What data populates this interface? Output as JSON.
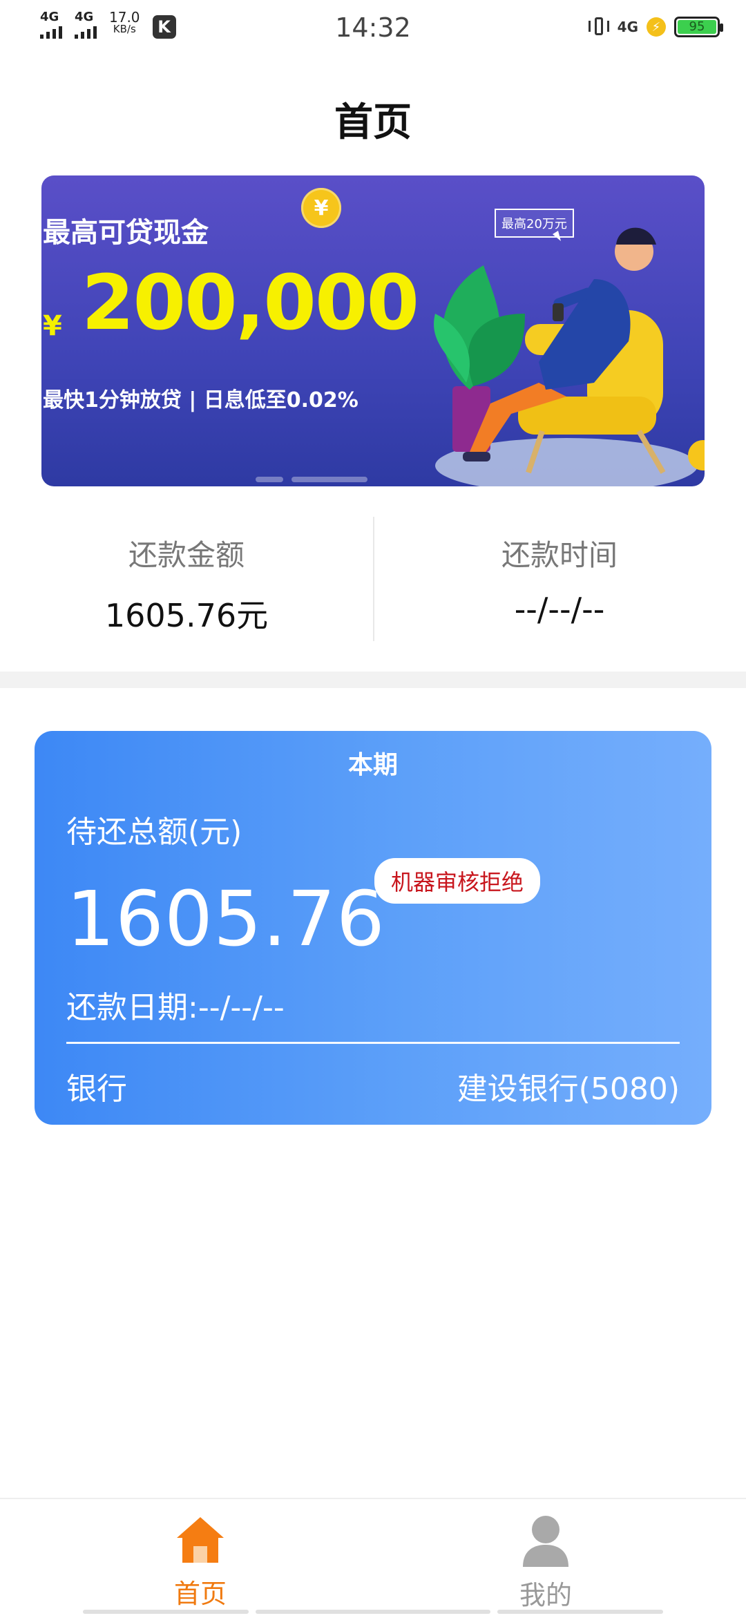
{
  "status_bar": {
    "sim1": "4G",
    "sim2": "4G",
    "speed_value": "17.0",
    "speed_unit": "KB/s",
    "app_badge": "K",
    "time": "14:32",
    "network": "4G",
    "battery": "95"
  },
  "header": {
    "title": "首页"
  },
  "banner": {
    "headline": "最高可贷现金",
    "currency_symbol": "¥",
    "amount": "200,000",
    "subline": "最快1分钟放贷 | 日息低至0.02%",
    "bubble": "最高20万元",
    "coin_symbol": "¥"
  },
  "summary": {
    "repay_amount_label": "还款金额",
    "repay_amount_value": "1605.76元",
    "repay_time_label": "还款时间",
    "repay_time_value": "--/--/--"
  },
  "card": {
    "period": "本期",
    "total_label": "待还总额(元)",
    "total_amount": "1605.76",
    "status_badge": "机器审核拒绝",
    "due_date": "还款日期:--/--/--",
    "bank_label": "银行",
    "bank_value": "建设银行(5080)"
  },
  "tabbar": {
    "home_label": "首页",
    "mine_label": "我的"
  },
  "colors": {
    "accent_orange": "#f07a10",
    "card_blue": "#3d88f5",
    "badge_red": "#c8161d"
  }
}
